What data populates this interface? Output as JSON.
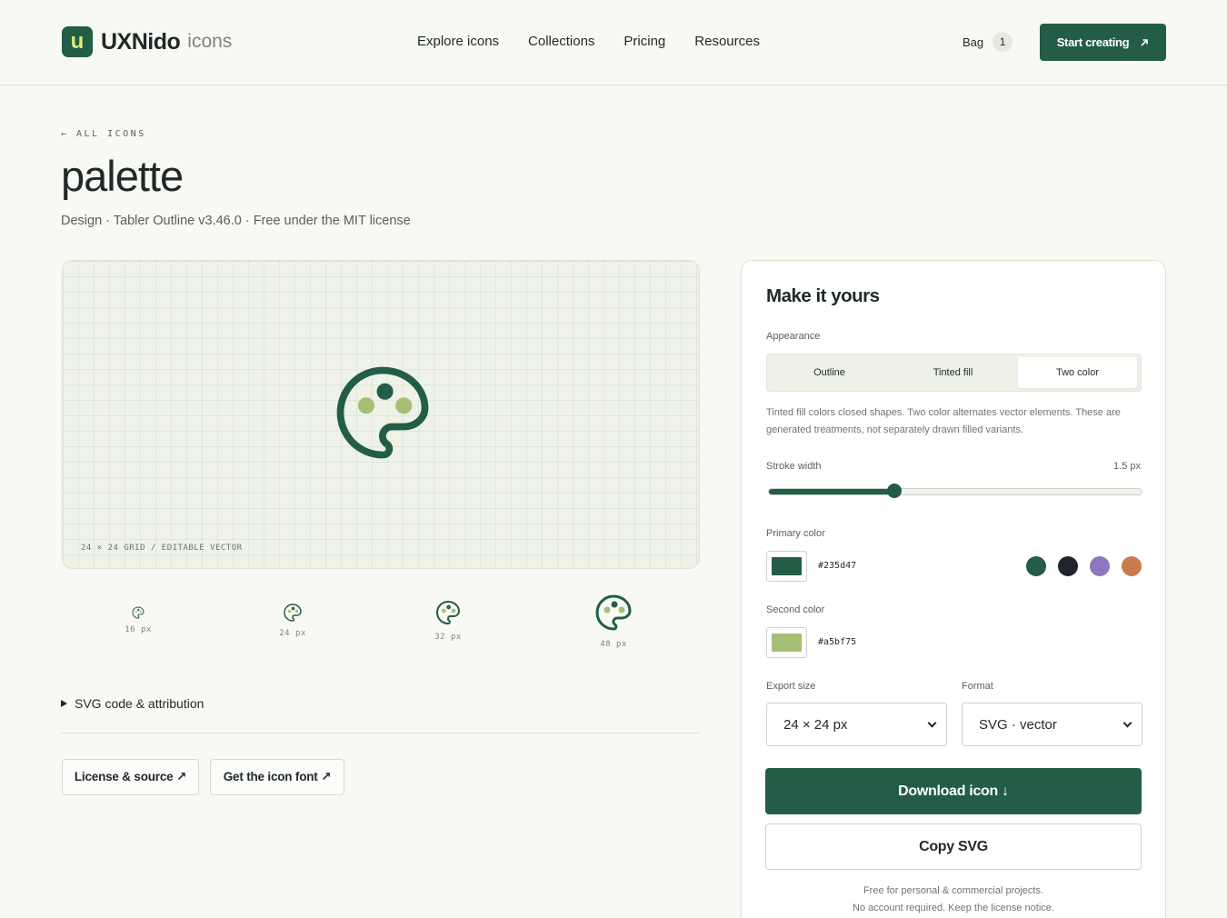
{
  "header": {
    "logo_letter": "u",
    "logo_name": "UXNido",
    "logo_sub": "icons",
    "nav": [
      "Explore icons",
      "Collections",
      "Pricing",
      "Resources"
    ],
    "bag_label": "Bag",
    "bag_count": "1",
    "cta_label": "Start creating",
    "cta_icon": "arrow-up-right-icon"
  },
  "page": {
    "back_link": "← ALL ICONS",
    "title": "palette",
    "subtitle": "Design · Tabler Outline v3.46.0 · Free under the MIT license"
  },
  "preview": {
    "caption": "24 × 24 GRID / EDITABLE VECTOR",
    "icon": "palette-icon",
    "sizes": [
      "16 px",
      "24 px",
      "32 px",
      "48 px"
    ]
  },
  "details": {
    "svg_toggle": "SVG code & attribution",
    "license_button": "License & source ↗",
    "font_button": "Get the icon font ↗"
  },
  "panel": {
    "title": "Make it yours",
    "appearance_label": "Appearance",
    "appearance_options": [
      "Outline",
      "Tinted fill",
      "Two color"
    ],
    "appearance_selected": "Two color",
    "note": "Tinted fill colors closed shapes. Two color alternates vector elements. These are generated treatments, not separately drawn filled variants.",
    "stroke_label": "Stroke width",
    "stroke_value": "1.5 px",
    "stroke_fraction": 0.34,
    "primary_label": "Primary color",
    "primary_hex": "#235d47",
    "presets": [
      "#235d47",
      "#1f2430",
      "#8d78bd",
      "#c97b4c"
    ],
    "second_label": "Second color",
    "second_hex": "#a5bf75",
    "export_label": "Export size",
    "export_value": "24 × 24 px",
    "format_label": "Format",
    "format_value": "SVG · vector",
    "download_label": "Download icon ↓",
    "copy_label": "Copy SVG",
    "footnote_1": "Free for personal & commercial projects.",
    "footnote_2": "No account required. Keep the license notice."
  }
}
